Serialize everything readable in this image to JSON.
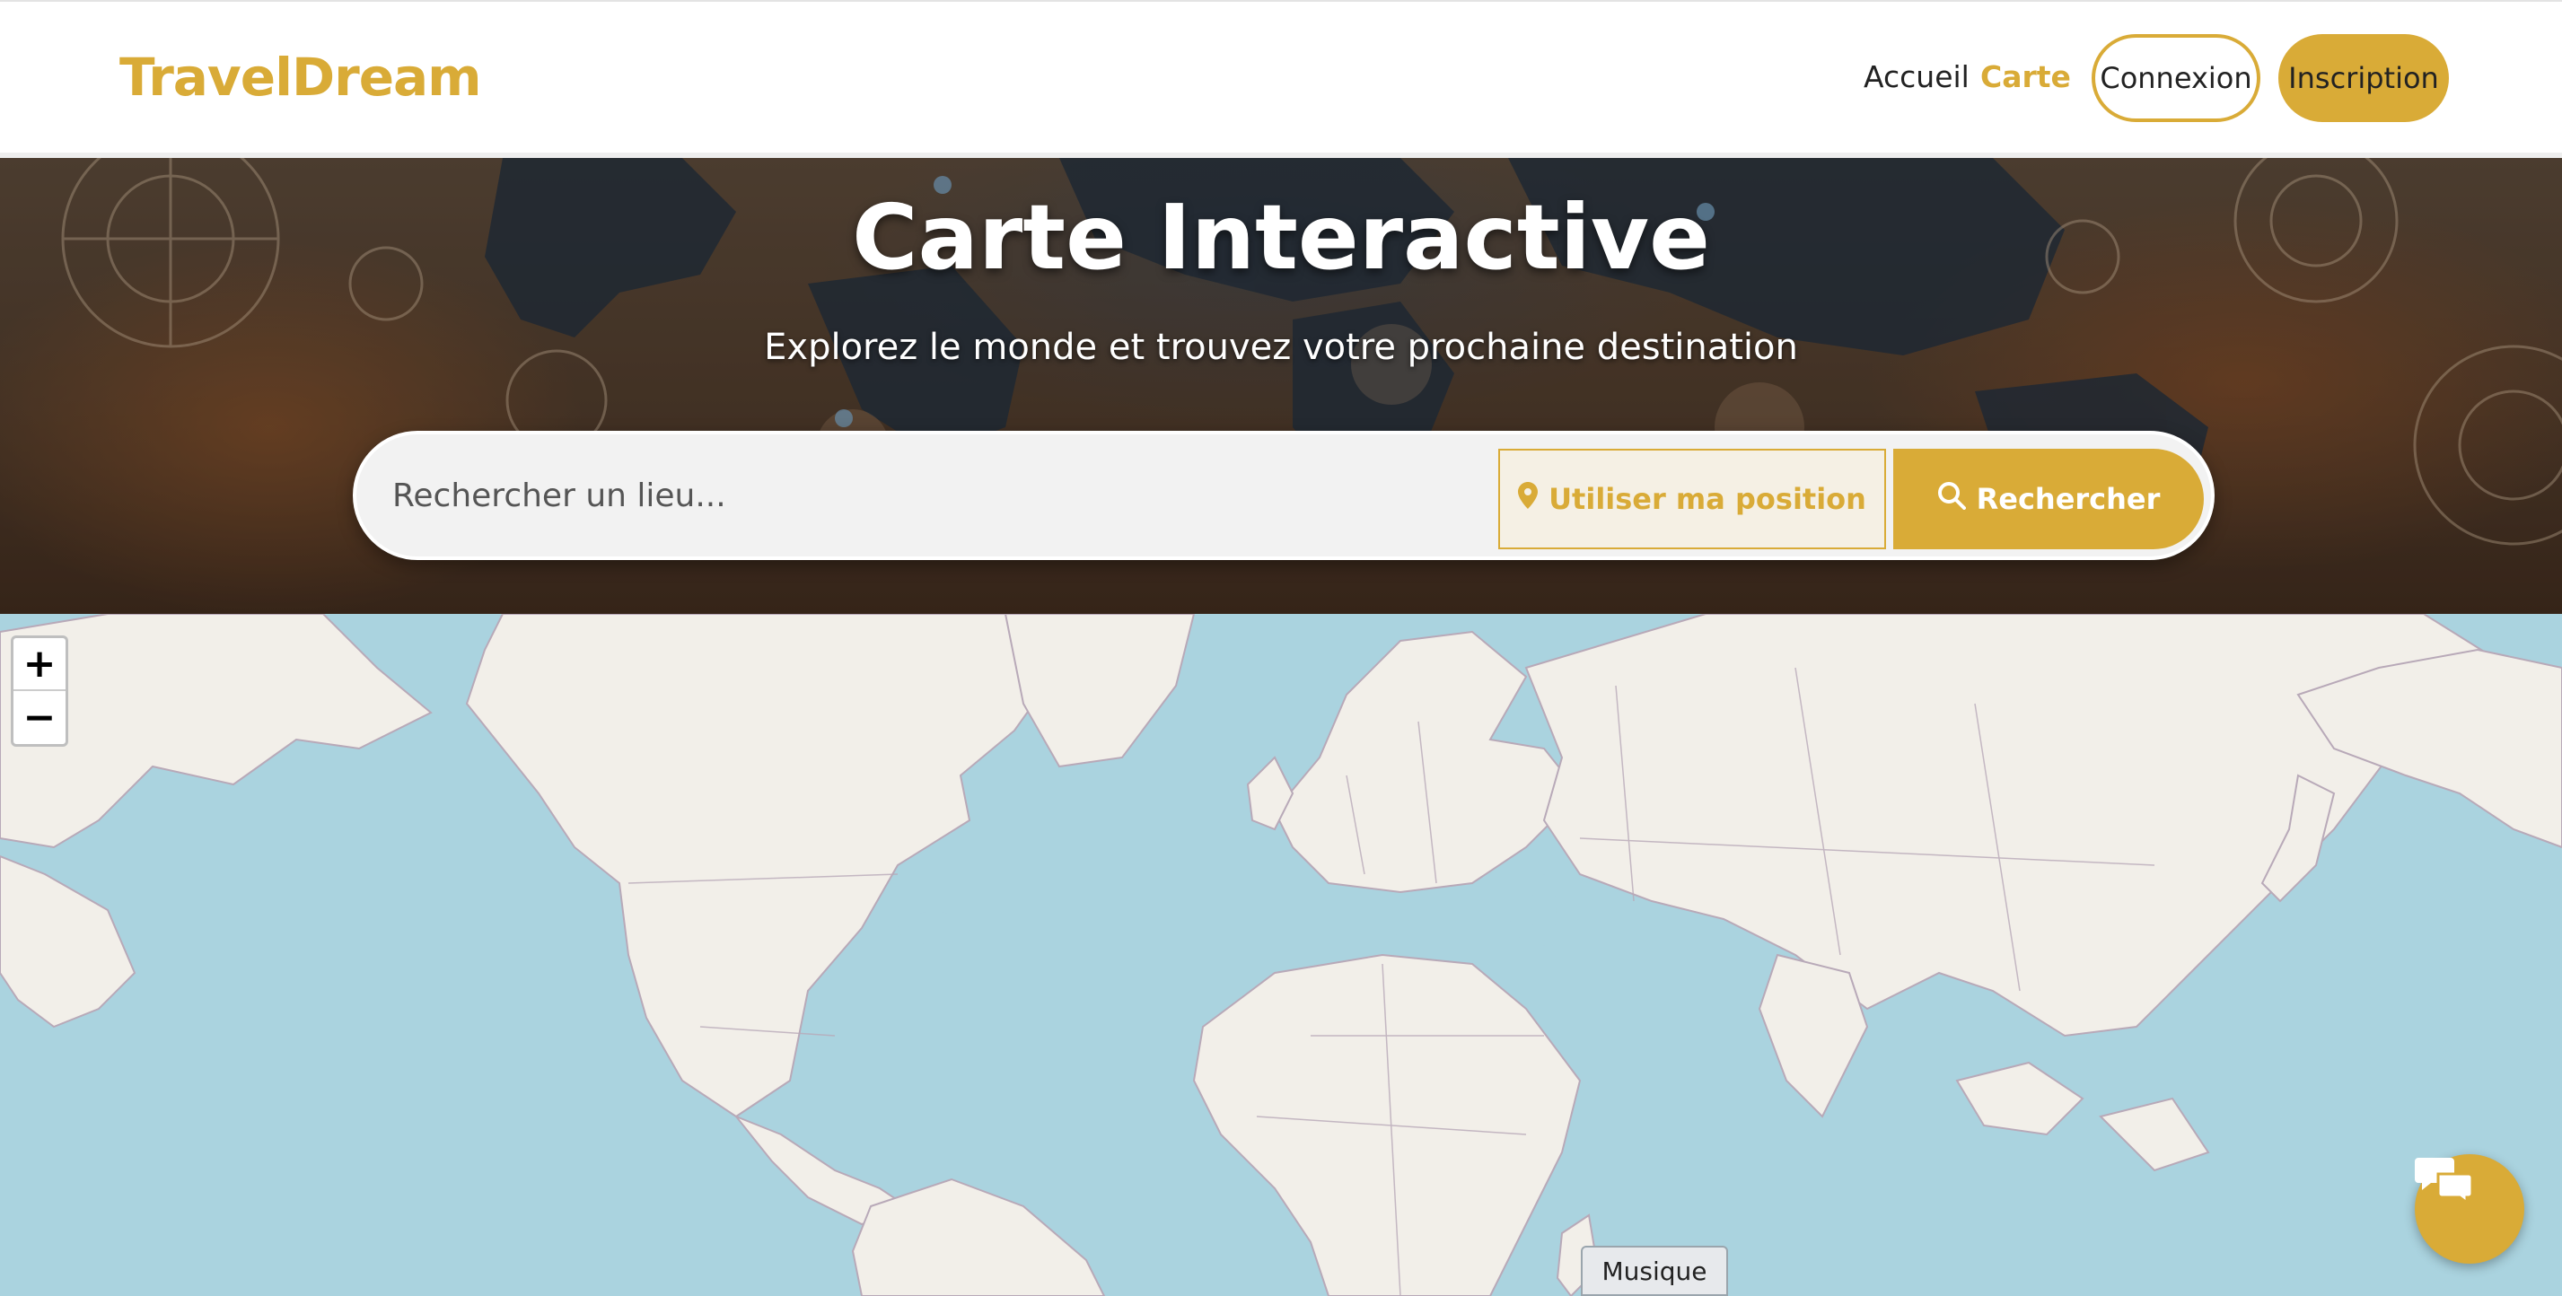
{
  "header": {
    "brand": "TravelDream",
    "nav": {
      "home": "Accueil",
      "map": "Carte"
    },
    "login_label": "Connexion",
    "signup_label": "Inscription"
  },
  "hero": {
    "title": "Carte Interactive",
    "subtitle": "Explorez le monde et trouvez votre prochaine destination",
    "search": {
      "placeholder": "Rechercher un lieu...",
      "value": "",
      "use_location_label": "Utiliser ma position",
      "search_label": "Rechercher"
    }
  },
  "map": {
    "zoom_in": "+",
    "zoom_out": "−",
    "category_tag": "Musique"
  },
  "icons": {
    "location": "map-marker-icon",
    "search": "magnifier-icon",
    "chat": "chat-bubbles-icon"
  },
  "colors": {
    "accent": "#d9ab37",
    "water": "#aad3df",
    "land": "#f2efe9"
  }
}
